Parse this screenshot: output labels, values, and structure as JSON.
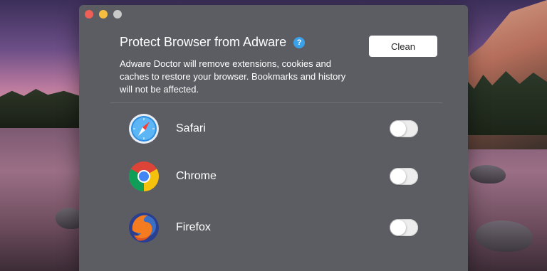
{
  "window": {
    "title": "Protect Browser from Adware",
    "help_glyph": "?",
    "description": "Adware Doctor will remove extensions, cookies and caches to restore your browser. Bookmarks and history will not be affected.",
    "clean_label": "Clean"
  },
  "browsers": [
    {
      "name": "Safari",
      "icon": "safari-icon",
      "enabled": false
    },
    {
      "name": "Chrome",
      "icon": "chrome-icon",
      "enabled": false
    },
    {
      "name": "Firefox",
      "icon": "firefox-icon",
      "enabled": false
    }
  ],
  "colors": {
    "window_bg": "#5c5d63",
    "button_bg": "#ffffff",
    "help_badge": "#3aa0e8"
  }
}
